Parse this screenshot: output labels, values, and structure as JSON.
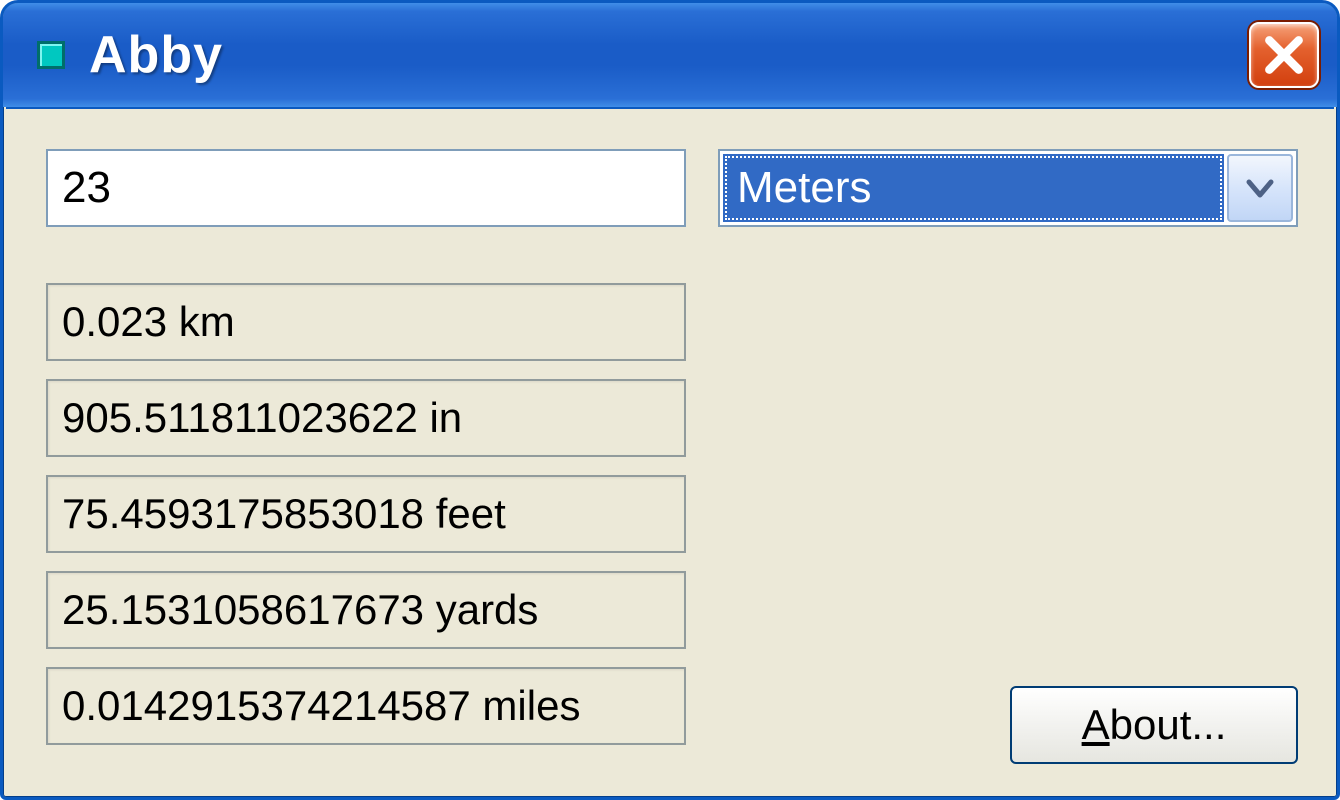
{
  "window": {
    "title": "Abby"
  },
  "input": {
    "value": "23",
    "unit_selected": "Meters"
  },
  "results": [
    "0.023 km",
    "905.511811023622 in",
    "75.4593175853018 feet",
    "25.1531058617673 yards",
    "0.0142915374214587 miles"
  ],
  "buttons": {
    "about_prefix": "A",
    "about_rest": "bout..."
  }
}
